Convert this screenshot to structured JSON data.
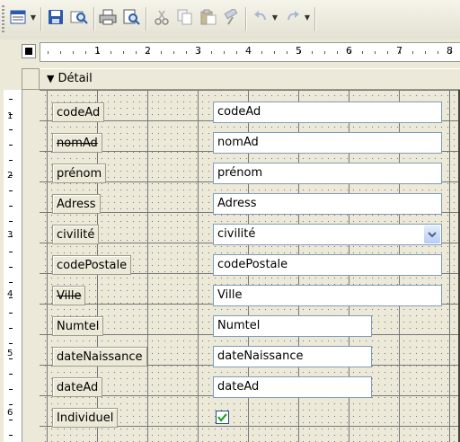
{
  "toolbar": {
    "buttons": [
      "view-icon",
      "save-icon",
      "search-icon",
      "print-icon",
      "print-preview-icon",
      "cut-icon",
      "copy-icon",
      "paste-icon",
      "format-painter-icon",
      "undo-icon",
      "redo-icon"
    ]
  },
  "ruler": {
    "labels": [
      "1",
      "2",
      "3",
      "4",
      "5",
      "6",
      "7",
      "8"
    ],
    "vertical_labels": [
      "1",
      "2",
      "3",
      "4",
      "5",
      "6"
    ]
  },
  "section": {
    "title": "Détail"
  },
  "form": {
    "rows": [
      {
        "label": "codeAd",
        "value": "codeAd",
        "type": "text"
      },
      {
        "label": "nomAd",
        "value": "nomAd",
        "type": "text"
      },
      {
        "label": "prénom",
        "value": "prénom",
        "type": "text"
      },
      {
        "label": "Adress",
        "value": "Adress",
        "type": "text"
      },
      {
        "label": "civilité",
        "value": "civilité",
        "type": "combo"
      },
      {
        "label": "codePostale",
        "value": "codePostale",
        "type": "text"
      },
      {
        "label": "Ville",
        "value": "Ville",
        "type": "text"
      },
      {
        "label": "Numtel",
        "value": "Numtel",
        "type": "text"
      },
      {
        "label": "dateNaissance",
        "value": "dateNaissance",
        "type": "text"
      },
      {
        "label": "dateAd",
        "value": "dateAd",
        "type": "text"
      },
      {
        "label": "Individuel",
        "value": "",
        "type": "checkbox",
        "checked": true
      }
    ]
  },
  "colors": {
    "accent_check": "#21a121",
    "field_border": "#7f9db9",
    "background": "#ece9d8"
  }
}
